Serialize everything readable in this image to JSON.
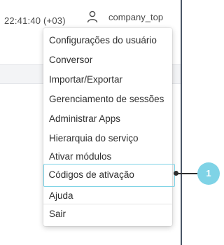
{
  "header": {
    "clock": "22:41:40 (+03)",
    "user_icon": "user-icon",
    "username": "company_top"
  },
  "menu": {
    "items": [
      {
        "label": "Configurações do usuário"
      },
      {
        "label": "Conversor"
      },
      {
        "label": "Importar/Exportar"
      },
      {
        "label": "Gerenciamento de sessões"
      },
      {
        "label": "Administrar Apps"
      },
      {
        "label": "Hierarquia do serviço"
      },
      {
        "label": "Ativar módulos"
      },
      {
        "label": "Códigos de ativação",
        "highlighted": true
      },
      {
        "label": "Ajuda"
      },
      {
        "label": "Sair"
      }
    ]
  },
  "callout": {
    "number": "1"
  },
  "colors": {
    "accent": "#7fd3e6",
    "frame": "#4a5566"
  }
}
